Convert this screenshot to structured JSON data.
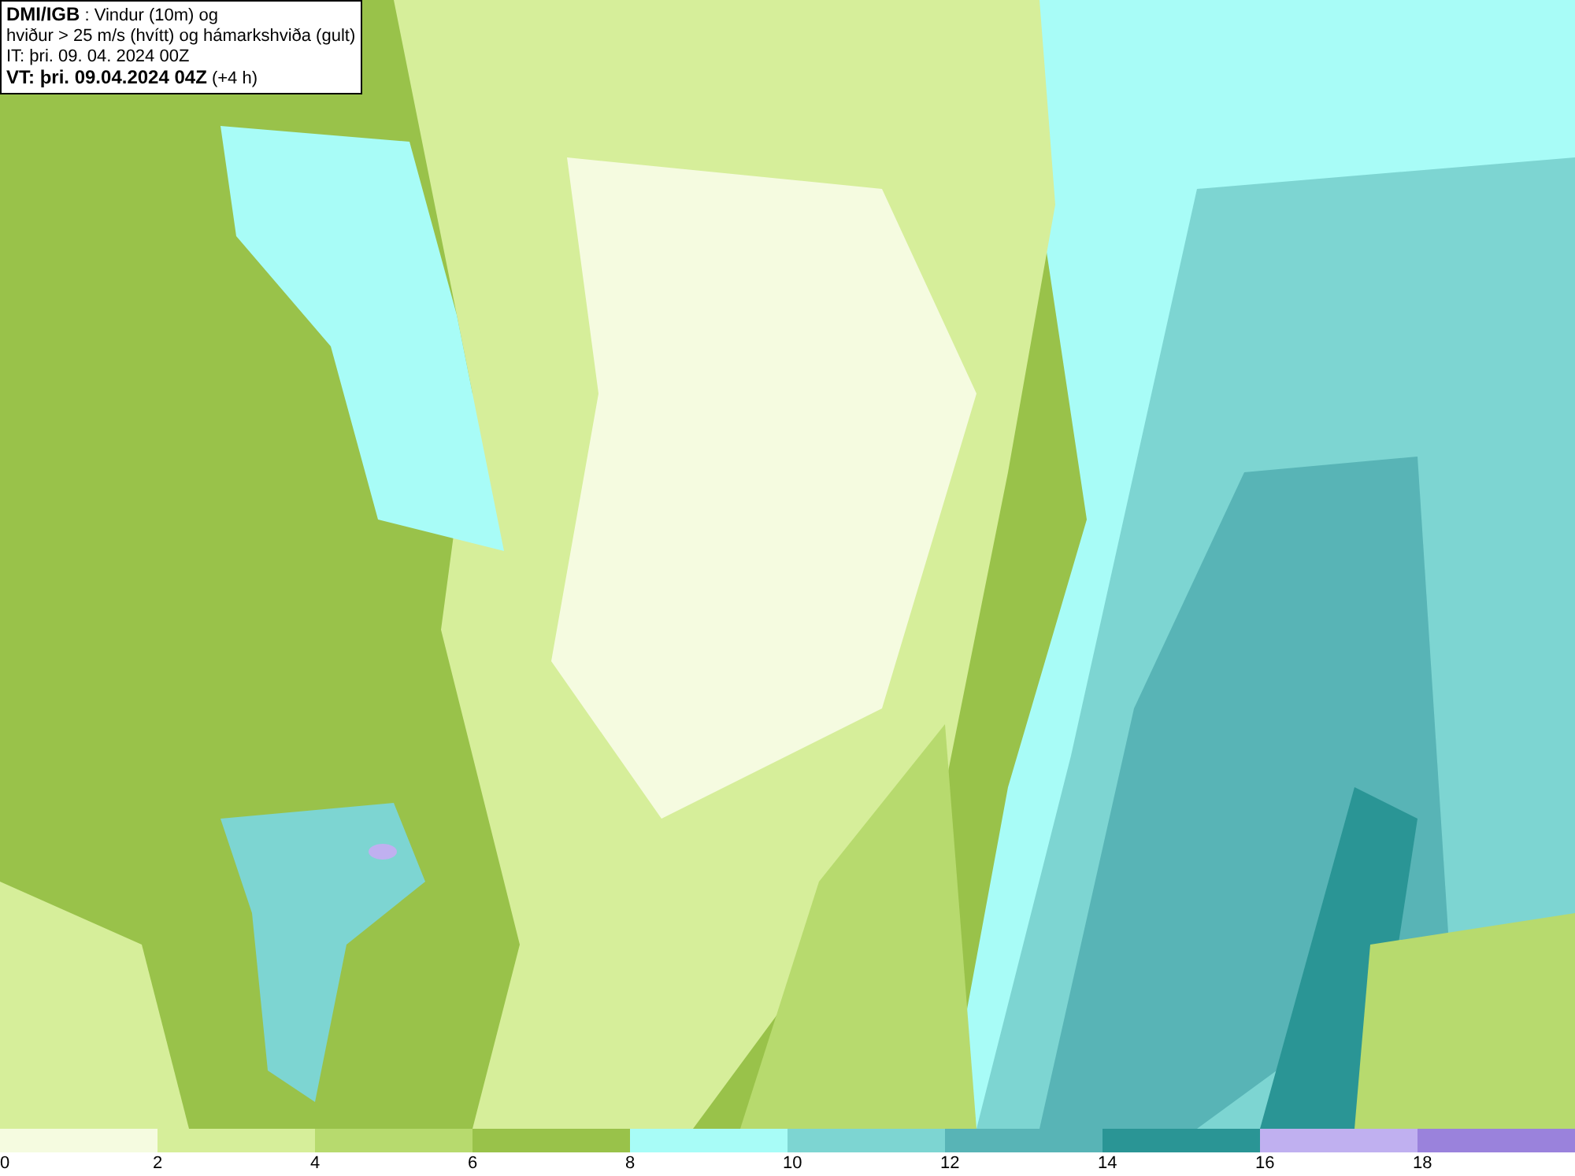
{
  "title_box": {
    "lines": [
      "**DMI/IGB** : Vindur (10m) og",
      "hviður > 25 m/s (hvítt) og hámarkshviða (gult)",
      "IT: þri. 09. 04. 2024 00Z",
      "**VT: þri. 09.04.2024 04Z** (+4 h)"
    ]
  },
  "legend": [
    {
      "label": "0",
      "color": "#f5fbe0"
    },
    {
      "label": "2",
      "color": "#d6ee9a"
    },
    {
      "label": "4",
      "color": "#b7da6e"
    },
    {
      "label": "6",
      "color": "#99c24a"
    },
    {
      "label": "8",
      "color": "#a8fcf7"
    },
    {
      "label": "10",
      "color": "#7dd5d2"
    },
    {
      "label": "12",
      "color": "#58b4b6"
    },
    {
      "label": "14",
      "color": "#2a9595"
    },
    {
      "label": "16",
      "color": "#c0b0f0"
    },
    {
      "label": "18",
      "color": "#9a82dc"
    }
  ]
}
